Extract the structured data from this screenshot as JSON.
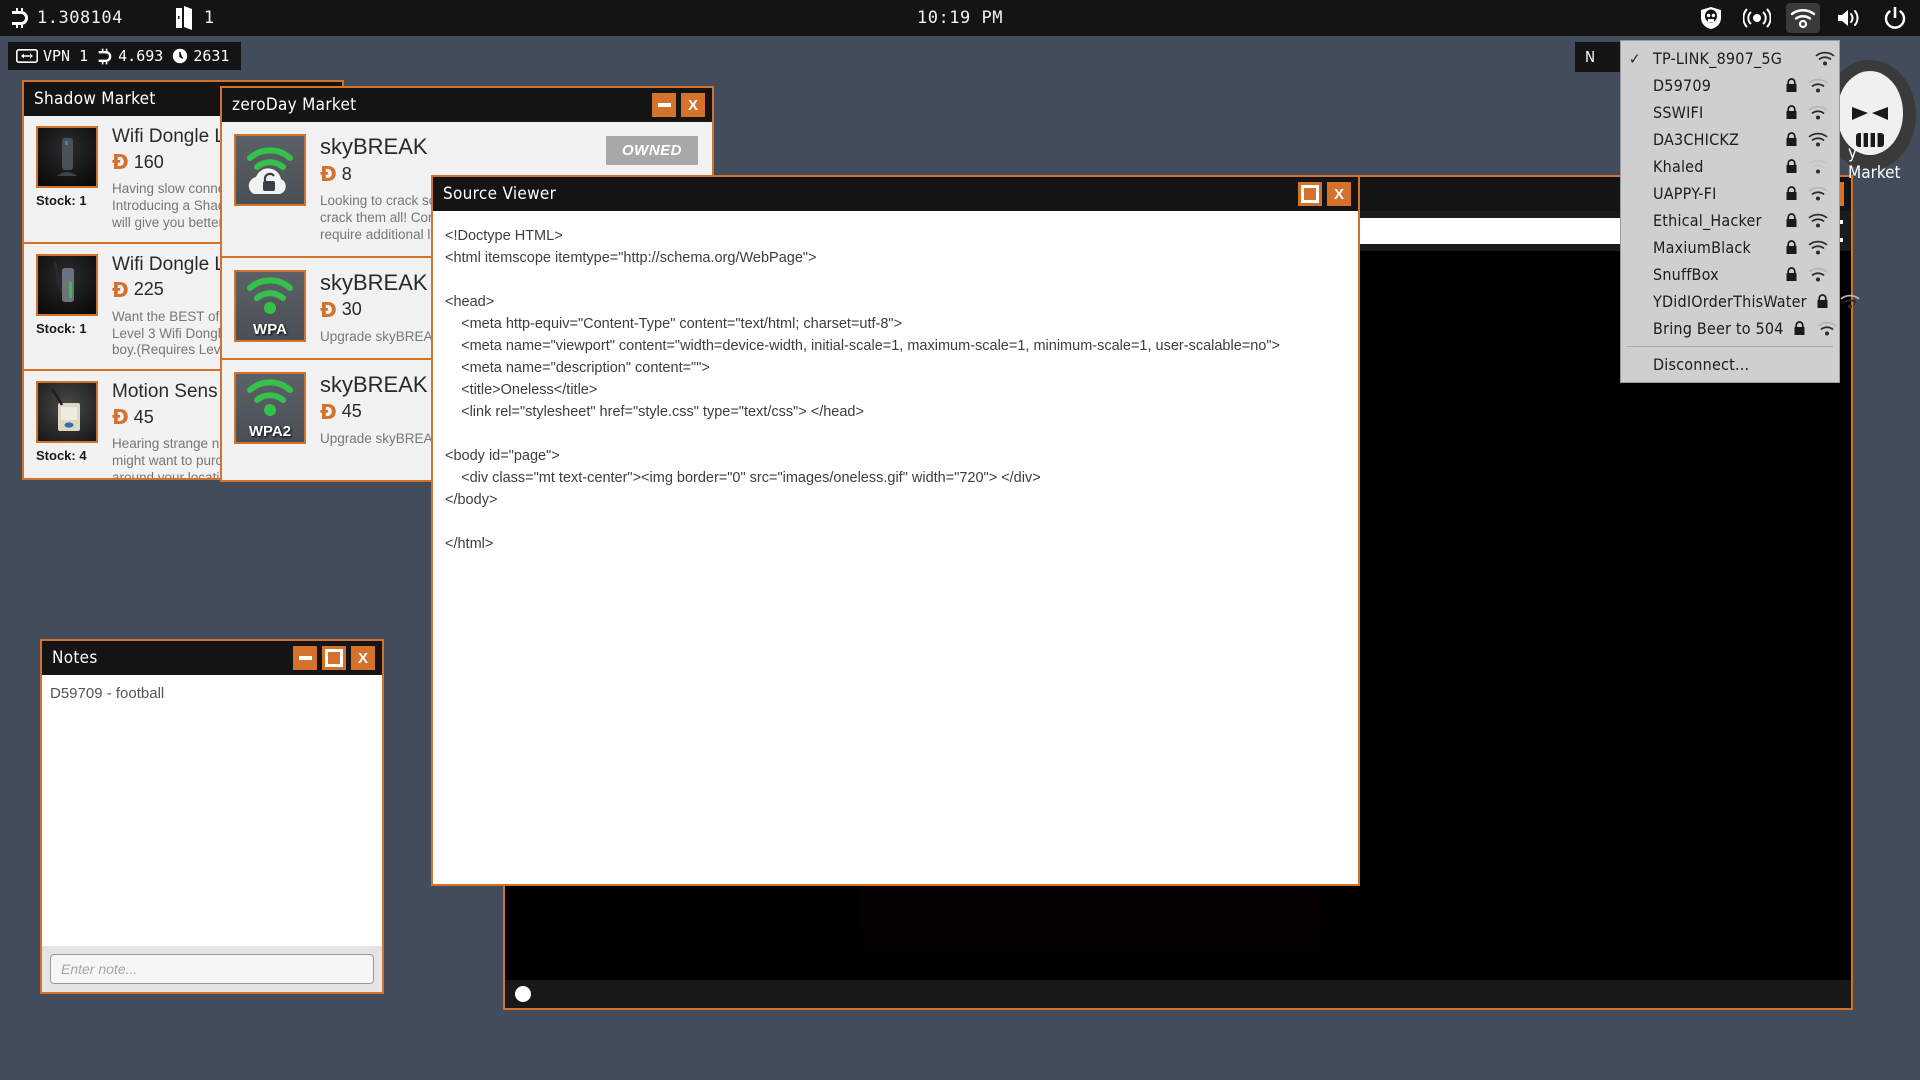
{
  "topbar": {
    "coin_icon": "dashcoin-icon",
    "coin_value": "1.308104",
    "door_icon": "door-icon",
    "door_value": "1",
    "clock": "10:19 PM",
    "tray": [
      {
        "name": "skull-shield-icon",
        "label": "Antivirus"
      },
      {
        "name": "broadcast-icon",
        "label": "Broadcast"
      },
      {
        "name": "wifi-icon",
        "label": "Wifi"
      },
      {
        "name": "volume-icon",
        "label": "Volume"
      },
      {
        "name": "power-icon",
        "label": "Power"
      }
    ]
  },
  "status_pill": {
    "vpn_icon": "vpn-icon",
    "vpn_label": "VPN 1",
    "coin_icon": "dashcoin-icon",
    "coin_value": "4.693",
    "clock_icon": "clock-icon",
    "clock_value": "2631"
  },
  "shadow_market": {
    "title": "Shadow Market",
    "items": [
      {
        "name": "Wifi Dongle L",
        "price": "160",
        "stock": "Stock: 1",
        "desc": "Having slow conne\nIntroducing a Shad\nwill give you better",
        "thumb": "wifi-dongle-level1-thumb"
      },
      {
        "name": "Wifi Dongle L",
        "price": "225",
        "stock": "Stock: 1",
        "desc": "Want the BEST of th\nLevel 3 Wifi Dongle\nboy.(Requires Leve",
        "thumb": "wifi-dongle-level3-thumb"
      },
      {
        "name": "Motion Sens",
        "price": "45",
        "stock": "Stock: 4",
        "desc": "Hearing strange no\nmight want to purch\naround your locatio",
        "thumb": "motion-sensor-thumb"
      }
    ]
  },
  "zeroday_market": {
    "title": "zeroDay Market",
    "items": [
      {
        "name": "skyBREAK",
        "price": "8",
        "badge": "OWNED",
        "icon_caption": "",
        "desc": "Looking to crack som\ncrack them all! Comes\nrequire additional libr"
      },
      {
        "name": "skyBREAK - W",
        "price": "30",
        "badge": "",
        "icon_caption": "WPA",
        "desc": "Upgrade skyBREAK w"
      },
      {
        "name": "skyBREAK - W",
        "price": "45",
        "badge": "",
        "icon_caption": "WPA2",
        "desc": "Upgrade skyBREAK w"
      }
    ]
  },
  "source_viewer": {
    "title": "Source Viewer",
    "code": "<!Doctype HTML>\n<html itemscope itemtype=\"http://schema.org/WebPage\">\n\n<head>\n    <meta http-equiv=\"Content-Type\" content=\"text/html; charset=utf-8\">\n    <meta name=\"viewport\" content=\"width=device-width, initial-scale=1, maximum-scale=1, minimum-scale=1, user-scalable=no\">\n    <meta name=\"description\" content=\"\">\n    <title>Oneless</title>\n    <link rel=\"stylesheet\" href=\"style.css\" type=\"text/css\"> </head>\n\n<body id=\"page\">\n    <div class=\"mt text-center\"><img border=\"0\" src=\"images/oneless.gif\" width=\"720\"> </div>\n</body>\n\n</html>"
  },
  "notes": {
    "title": "Notes",
    "lines": [
      "D59709 - football"
    ],
    "input_placeholder": "Enter note..."
  },
  "browser": {
    "taskbar_label_left": "N",
    "taskbar_label_right": "y Market"
  },
  "wifi_menu": {
    "networks": [
      {
        "ssid": "TP-LINK_8907_5G",
        "connected": true,
        "locked": false,
        "strength": 3
      },
      {
        "ssid": "D59709",
        "connected": false,
        "locked": true,
        "strength": 2
      },
      {
        "ssid": "SSWIFI",
        "connected": false,
        "locked": true,
        "strength": 2
      },
      {
        "ssid": "DA3CHICKZ",
        "connected": false,
        "locked": true,
        "strength": 3
      },
      {
        "ssid": "Khaled",
        "connected": false,
        "locked": true,
        "strength": 1
      },
      {
        "ssid": "UAPPY-FI",
        "connected": false,
        "locked": true,
        "strength": 2
      },
      {
        "ssid": "Ethical_Hacker",
        "connected": false,
        "locked": true,
        "strength": 3
      },
      {
        "ssid": "MaxiumBlack",
        "connected": false,
        "locked": true,
        "strength": 3
      },
      {
        "ssid": "SnuffBox",
        "connected": false,
        "locked": true,
        "strength": 2
      },
      {
        "ssid": "YDidIOrderThisWater",
        "connected": false,
        "locked": true,
        "strength": 2
      },
      {
        "ssid": "Bring Beer to 504",
        "connected": false,
        "locked": true,
        "strength": 2
      }
    ],
    "disconnect_label": "Disconnect..."
  },
  "colors": {
    "accent": "#d4722c",
    "window_title_bg": "#141414",
    "desktop": "#434c5a",
    "menu_bg": "#cfcfcf"
  }
}
